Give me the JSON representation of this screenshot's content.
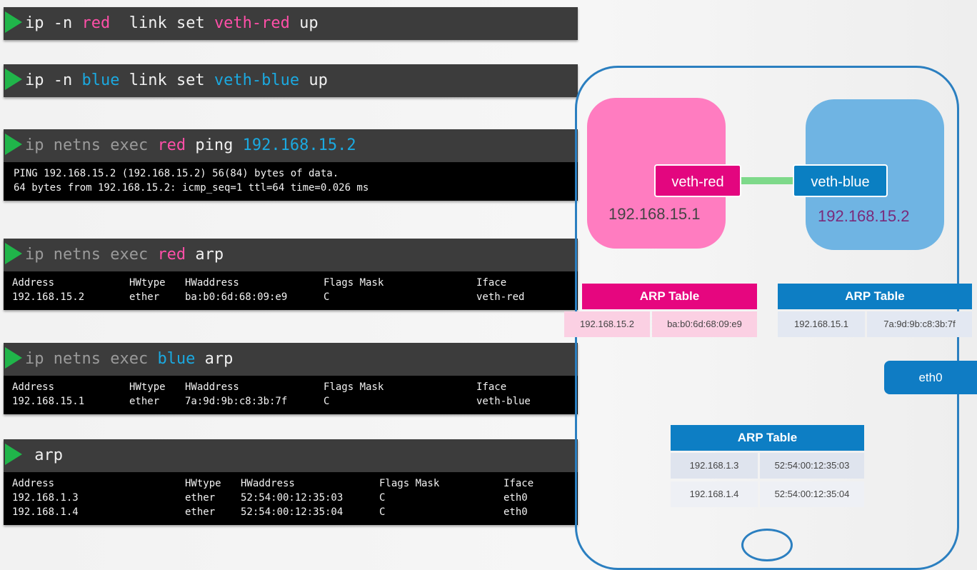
{
  "commands": [
    {
      "parts": [
        {
          "t": "ip -n ",
          "c": ""
        },
        {
          "t": "red",
          "c": "pink"
        },
        {
          "t": "  link set ",
          "c": ""
        },
        {
          "t": "veth-red",
          "c": "pink"
        },
        {
          "t": " up",
          "c": ""
        }
      ]
    },
    {
      "parts": [
        {
          "t": "ip -n ",
          "c": ""
        },
        {
          "t": "blue",
          "c": "cyan"
        },
        {
          "t": " link set ",
          "c": ""
        },
        {
          "t": "veth-blue",
          "c": "cyan"
        },
        {
          "t": " up",
          "c": ""
        }
      ]
    },
    {
      "parts": [
        {
          "t": "ip netns exec ",
          "c": "gray"
        },
        {
          "t": "red",
          "c": "pink"
        },
        {
          "t": " ping ",
          "c": ""
        },
        {
          "t": "192.168.15.2",
          "c": "cyan"
        }
      ]
    },
    {
      "parts": [
        {
          "t": "ip netns exec ",
          "c": "gray"
        },
        {
          "t": "red",
          "c": "pink"
        },
        {
          "t": " arp",
          "c": ""
        }
      ]
    },
    {
      "parts": [
        {
          "t": "ip netns exec ",
          "c": "gray"
        },
        {
          "t": "blue",
          "c": "cyan"
        },
        {
          "t": " arp",
          "c": ""
        }
      ]
    },
    {
      "parts": [
        {
          "t": " arp",
          "c": ""
        }
      ]
    }
  ],
  "ping_output": [
    "PING 192.168.15.2 (192.168.15.2) 56(84) bytes of data.",
    "64 bytes from 192.168.15.2: icmp_seq=1 ttl=64 time=0.026 ms"
  ],
  "arp_red": {
    "header": [
      "Address",
      "HWtype",
      "HWaddress",
      "Flags Mask",
      "Iface"
    ],
    "rows": [
      [
        "192.168.15.2",
        "ether",
        "ba:b0:6d:68:09:e9",
        "C",
        "veth-red"
      ]
    ]
  },
  "arp_blue": {
    "header": [
      "Address",
      "HWtype",
      "HWaddress",
      "Flags Mask",
      "Iface"
    ],
    "rows": [
      [
        "192.168.15.1",
        "ether",
        "7a:9d:9b:c8:3b:7f",
        "C",
        "veth-blue"
      ]
    ]
  },
  "arp_host": {
    "header": [
      "Address",
      "HWtype",
      "HWaddress",
      "Flags Mask",
      "Iface"
    ],
    "rows": [
      [
        "192.168.1.3",
        "ether",
        "52:54:00:12:35:03",
        "C",
        "eth0"
      ],
      [
        "192.168.1.4",
        "ether",
        "52:54:00:12:35:04",
        "C",
        "eth0"
      ]
    ]
  },
  "diagram": {
    "veth_red": "veth-red",
    "veth_blue": "veth-blue",
    "ip_red": "192.168.15.1",
    "ip_blue": "192.168.15.2",
    "eth0": "eth0",
    "arp_title": "ARP Table",
    "red_table": [
      [
        "192.168.15.2",
        "ba:b0:6d:68:09:e9"
      ]
    ],
    "blue_table": [
      [
        "192.168.15.1",
        "7a:9d:9b:c8:3b:7f"
      ]
    ],
    "host_table": [
      [
        "192.168.1.3",
        "52:54:00:12:35:03"
      ],
      [
        "192.168.1.4",
        "52:54:00:12:35:04"
      ]
    ]
  },
  "colors": {
    "pink": "#ff4fa8",
    "cyan": "#1ba9e0",
    "green": "#20b54a",
    "red_ns": "#ff7cc0",
    "blue_ns": "#6fb4e3",
    "host_border": "#2b7fc0"
  }
}
